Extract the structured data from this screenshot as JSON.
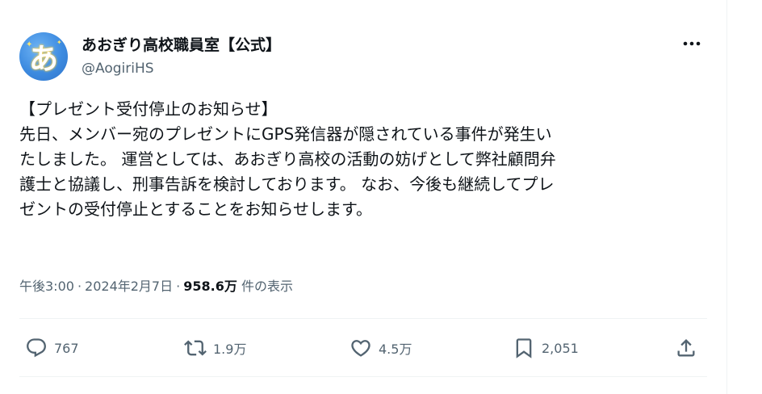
{
  "account": {
    "display_name": "あおぎり高校職員室【公式】",
    "handle": "@AogiriHS",
    "avatar_glyph": "あ",
    "avatar_color": "#3d8be0"
  },
  "tweet": {
    "lines": [
      "【プレゼント受付停止のお知らせ】",
      " 先日、メンバー宛のプレゼントにGPS発信器が隠されている事件が発生い",
      "たしました。 運営としては、あおぎり高校の活動の妨げとして弊社顧問弁",
      "護士と協議し、刑事告訴を検討しております。 なお、今後も継続してプレ",
      "ゼントの受付停止とすることをお知らせします。"
    ],
    "time": "午後3:00",
    "date": "2024年2月7日",
    "separator": "·",
    "views_count": "958.6万",
    "views_label": "件の表示"
  },
  "actions": {
    "reply": {
      "icon": "reply-icon",
      "count": "767"
    },
    "retweet": {
      "icon": "retweet-icon",
      "count": "1.9万"
    },
    "like": {
      "icon": "heart-icon",
      "count": "4.5万"
    },
    "bookmark": {
      "icon": "bookmark-icon",
      "count": "2,051"
    },
    "share": {
      "icon": "share-icon"
    }
  },
  "colors": {
    "text": "#0f1419",
    "secondary": "#536471",
    "divider": "#eff3f4"
  }
}
